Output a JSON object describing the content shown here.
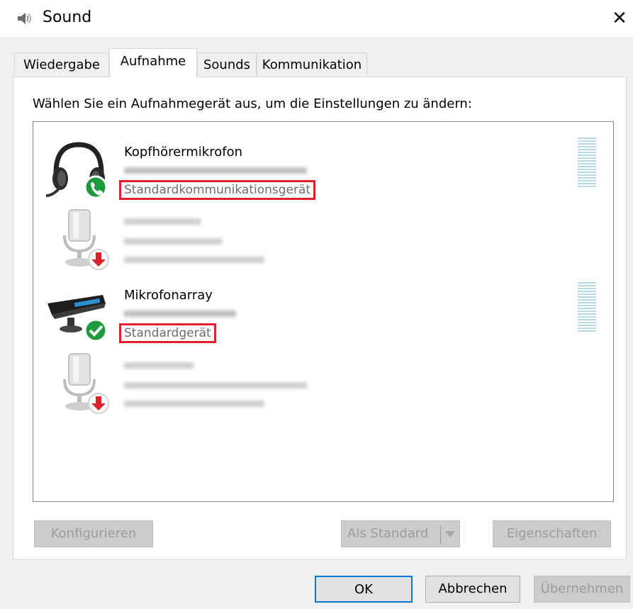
{
  "window": {
    "title": "Sound",
    "icon": "speaker-icon",
    "close_label": "✕"
  },
  "tabs": [
    {
      "label": "Wiedergabe",
      "active": false
    },
    {
      "label": "Aufnahme",
      "active": true
    },
    {
      "label": "Sounds",
      "active": false
    },
    {
      "label": "Kommunikation",
      "active": false
    }
  ],
  "instruction": "Wählen Sie ein Aufnahmegerät aus, um die Einstellungen zu ändern:",
  "devices": [
    {
      "name": "Kopfhörermikrofon",
      "line1": "",
      "line2": "Standardkommunikationsgerät",
      "icon": "headset-icon",
      "status": "phone-check-icon",
      "enabled": true
    },
    {
      "name": "",
      "line1": "",
      "line2": "",
      "icon": "microphone-icon",
      "status": "disabled-arrow-icon",
      "enabled": false
    },
    {
      "name": "Mikrofonarray",
      "line1": "",
      "line2": "Standardgerät",
      "icon": "mic-array-icon",
      "status": "check-icon",
      "enabled": true
    },
    {
      "name": "",
      "line1": "",
      "line2": "",
      "icon": "microphone-icon",
      "status": "disabled-arrow-icon",
      "enabled": false
    }
  ],
  "buttons": {
    "configure": "Konfigurieren",
    "set_default": "Als Standard",
    "properties": "Eigenschaften",
    "ok": "OK",
    "cancel": "Abbrechen",
    "apply": "Übernehmen"
  },
  "colors": {
    "highlight": "#e0202a",
    "accent": "#0078d7",
    "status_green": "#1d9a3c",
    "status_red": "#d8232a"
  }
}
